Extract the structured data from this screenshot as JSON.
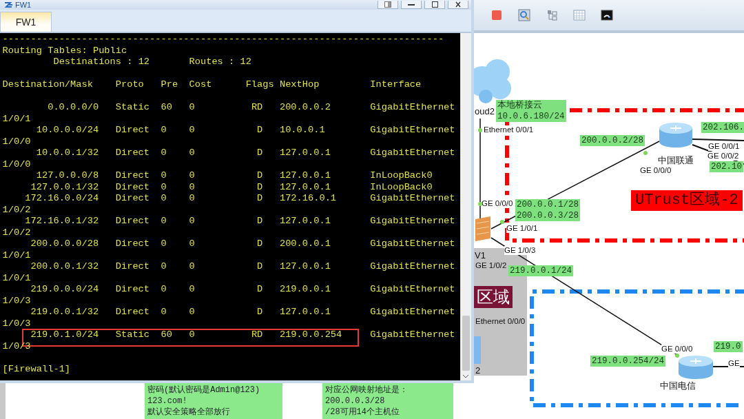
{
  "window": {
    "title": "FW1",
    "tabs": [
      {
        "label": "FW1",
        "selected": true
      }
    ]
  },
  "terminal": {
    "separator": "------------------------------------------------------------------------------",
    "title": "Routing Tables: Public",
    "summary": [
      "Destinations : 12",
      "Routes : 12"
    ],
    "columns": [
      "Destination/Mask",
      "Proto",
      "Pre",
      "Cost",
      "Flags",
      "NextHop",
      "Interface"
    ],
    "routes": [
      {
        "destination": "0.0.0.0/0",
        "proto": "Static",
        "pre": "60",
        "cost": "0",
        "flags": "RD",
        "nexthop": "200.0.0.2",
        "interface": "GigabitEthernet",
        "interface_wrap": "1/0/1",
        "highlighted": false
      },
      {
        "destination": "10.0.0.0/24",
        "proto": "Direct",
        "pre": "0",
        "cost": "0",
        "flags": "D",
        "nexthop": "10.0.0.1",
        "interface": "GigabitEthernet",
        "interface_wrap": "1/0/0",
        "highlighted": false
      },
      {
        "destination": "10.0.0.1/32",
        "proto": "Direct",
        "pre": "0",
        "cost": "0",
        "flags": "D",
        "nexthop": "127.0.0.1",
        "interface": "GigabitEthernet",
        "interface_wrap": "1/0/0",
        "highlighted": false
      },
      {
        "destination": "127.0.0.0/8",
        "proto": "Direct",
        "pre": "0",
        "cost": "0",
        "flags": "D",
        "nexthop": "127.0.0.1",
        "interface": "InLoopBack0",
        "highlighted": false
      },
      {
        "destination": "127.0.0.1/32",
        "proto": "Direct",
        "pre": "0",
        "cost": "0",
        "flags": "D",
        "nexthop": "127.0.0.1",
        "interface": "InLoopBack0",
        "highlighted": false
      },
      {
        "destination": "172.16.0.0/24",
        "proto": "Direct",
        "pre": "0",
        "cost": "0",
        "flags": "D",
        "nexthop": "172.16.0.1",
        "interface": "GigabitEthernet",
        "interface_wrap": "1/0/2",
        "highlighted": false
      },
      {
        "destination": "172.16.0.1/32",
        "proto": "Direct",
        "pre": "0",
        "cost": "0",
        "flags": "D",
        "nexthop": "127.0.0.1",
        "interface": "GigabitEthernet",
        "interface_wrap": "1/0/2",
        "highlighted": false
      },
      {
        "destination": "200.0.0.0/28",
        "proto": "Direct",
        "pre": "0",
        "cost": "0",
        "flags": "D",
        "nexthop": "200.0.0.1",
        "interface": "GigabitEthernet",
        "interface_wrap": "1/0/1",
        "highlighted": false
      },
      {
        "destination": "200.0.0.1/32",
        "proto": "Direct",
        "pre": "0",
        "cost": "0",
        "flags": "D",
        "nexthop": "127.0.0.1",
        "interface": "GigabitEthernet",
        "interface_wrap": "1/0/1",
        "highlighted": false
      },
      {
        "destination": "219.0.0.0/24",
        "proto": "Direct",
        "pre": "0",
        "cost": "0",
        "flags": "D",
        "nexthop": "219.0.0.1",
        "interface": "GigabitEthernet",
        "interface_wrap": "1/0/3",
        "highlighted": false
      },
      {
        "destination": "219.0.0.1/32",
        "proto": "Direct",
        "pre": "0",
        "cost": "0",
        "flags": "D",
        "nexthop": "127.0.0.1",
        "interface": "GigabitEthernet",
        "interface_wrap": "1/0/3",
        "highlighted": false
      },
      {
        "destination": "219.0.1.0/24",
        "proto": "Static",
        "pre": "60",
        "cost": "0",
        "flags": "RD",
        "nexthop": "219.0.0.254",
        "interface": "GigabitEthernet",
        "interface_wrap": "1/0/3",
        "highlighted": true
      }
    ],
    "prompt": "[Firewall-1]"
  },
  "topology": {
    "labels": [
      {
        "kind": "device",
        "text": "oud2"
      },
      {
        "kind": "note",
        "lines": [
          "本地桥接云",
          "10.0.6.180/24"
        ]
      },
      {
        "kind": "port",
        "text": "Ethernet 0/0/1"
      },
      {
        "kind": "note",
        "lines": [
          "200.0.0.2/28"
        ]
      },
      {
        "kind": "note",
        "lines": [
          "202.106."
        ]
      },
      {
        "kind": "port",
        "text": "GE 0/0/1"
      },
      {
        "kind": "port",
        "text": "GE 0/0/2"
      },
      {
        "kind": "device",
        "text": "中国联通"
      },
      {
        "kind": "port",
        "text": "GE 0/0/0"
      },
      {
        "kind": "note",
        "lines": [
          "202.10"
        ]
      },
      {
        "kind": "port",
        "text": "GE 0/0/0"
      },
      {
        "kind": "note",
        "lines": [
          "200.0.0.1/28",
          "200.0.0.3/28"
        ]
      },
      {
        "kind": "zone",
        "text": "UTrust区域-2"
      },
      {
        "kind": "port",
        "text": "GE 1/0/1"
      },
      {
        "kind": "port",
        "text": "GE 1/0/3"
      },
      {
        "kind": "device",
        "text": "V1"
      },
      {
        "kind": "port",
        "text": "GE 1/0/2"
      },
      {
        "kind": "note",
        "lines": [
          "219.0.0.1/24"
        ]
      },
      {
        "kind": "zone-dark",
        "text": "区域"
      },
      {
        "kind": "port",
        "text": "Ethernet 0/0/0"
      },
      {
        "kind": "device",
        "text": "2"
      },
      {
        "kind": "note",
        "lines": [
          "219.0.0.254/24"
        ]
      },
      {
        "kind": "port",
        "text": "GE 0/0/0"
      },
      {
        "kind": "note",
        "lines": [
          "219.0"
        ]
      },
      {
        "kind": "port",
        "text": "GE"
      },
      {
        "kind": "device",
        "text": "中国电信"
      }
    ]
  },
  "notes": [
    {
      "lines": [
        "密码(默认密码是Admin@123)",
        "123.com!",
        "默认安全策略全部放行"
      ]
    },
    {
      "lines": [
        "对应公网映射地址是：",
        "200.0.0.3/28",
        "/28可用14个主机位"
      ]
    }
  ]
}
